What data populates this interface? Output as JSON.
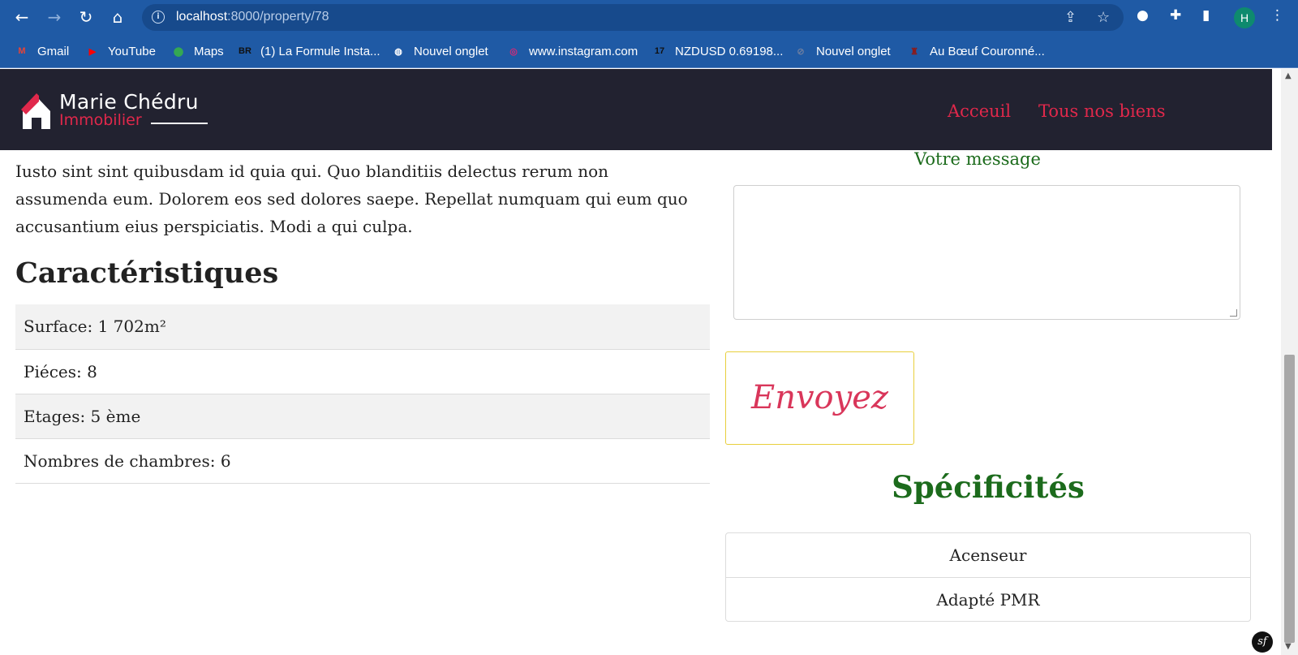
{
  "browser": {
    "url_host": "localhost",
    "url_path": ":8000/property/78",
    "profile_initial": "H",
    "bookmarks": [
      {
        "label": "Gmail",
        "icon": "gmail-icon",
        "color": "#ea4335",
        "glyph": "M"
      },
      {
        "label": "YouTube",
        "icon": "youtube-icon",
        "color": "#ff0000",
        "glyph": "▶"
      },
      {
        "label": "Maps",
        "icon": "maps-icon",
        "color": "#34a853",
        "glyph": "⬤"
      },
      {
        "label": "(1) La Formule Insta...",
        "icon": "br-icon",
        "color": "#111111",
        "glyph": "BR"
      },
      {
        "label": "Nouvel onglet",
        "icon": "globe-icon",
        "color": "#ffffff",
        "glyph": "◍"
      },
      {
        "label": "www.instagram.com",
        "icon": "instagram-icon",
        "color": "#d62976",
        "glyph": "◎"
      },
      {
        "label": "NZDUSD 0.69198...",
        "icon": "tradingview-icon",
        "color": "#111111",
        "glyph": "17"
      },
      {
        "label": "Nouvel onglet",
        "icon": "blank-page-icon",
        "color": "#6b7da0",
        "glyph": "⊘"
      },
      {
        "label": "Au Bœuf Couronné...",
        "icon": "restaurant-icon",
        "color": "#8b1a1a",
        "glyph": "♜"
      }
    ]
  },
  "site": {
    "brand_name": "Marie Chédru",
    "brand_sub": "Immobilier",
    "accent_color": "#e0284b",
    "nav": [
      "Acceuil",
      "Tous nos biens"
    ]
  },
  "property": {
    "description": "Iusto sint sint quibusdam id quia qui. Quo blanditiis delectus rerum non assumenda eum. Dolorem eos sed dolores saepe. Repellat numquam qui eum quo accusantium eius perspiciatis. Modi a qui culpa.",
    "features_title": "Caractéristiques",
    "features": [
      "Surface: 1 702m²",
      "Piéces: 8",
      "Etages: 5 ème",
      "Nombres de chambres: 6"
    ],
    "specs_title": "Spécificités",
    "specs": [
      "Acenseur",
      "Adapté PMR"
    ]
  },
  "contact": {
    "message_label": "Votre message",
    "message_value": "",
    "send_label": "Envoyez"
  }
}
